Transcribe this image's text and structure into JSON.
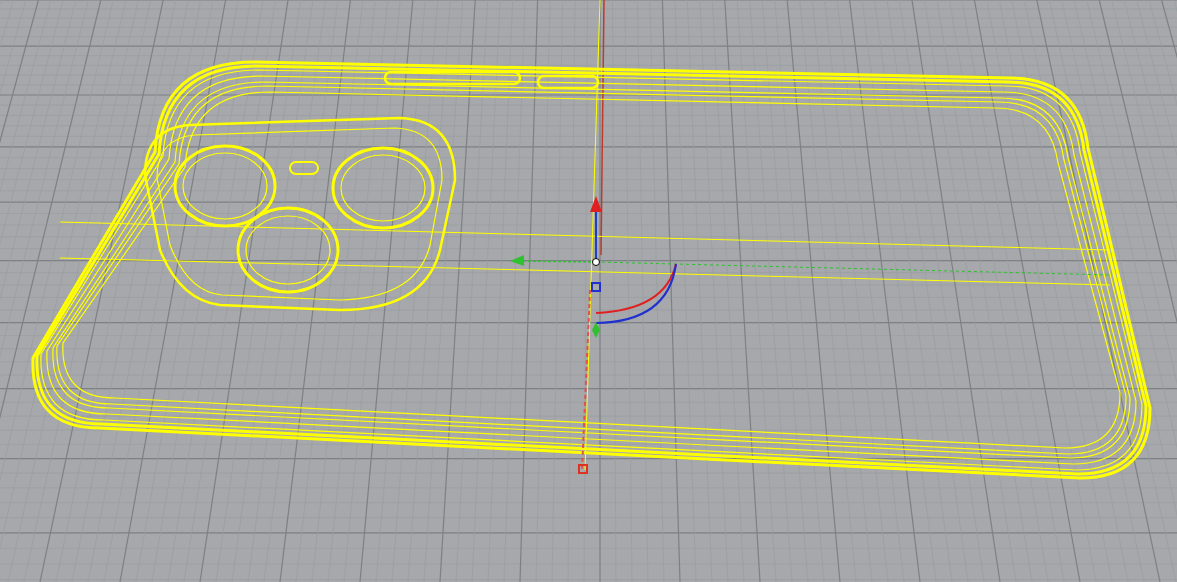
{
  "viewport": {
    "grid_visible": true,
    "gumball_visible": true
  }
}
